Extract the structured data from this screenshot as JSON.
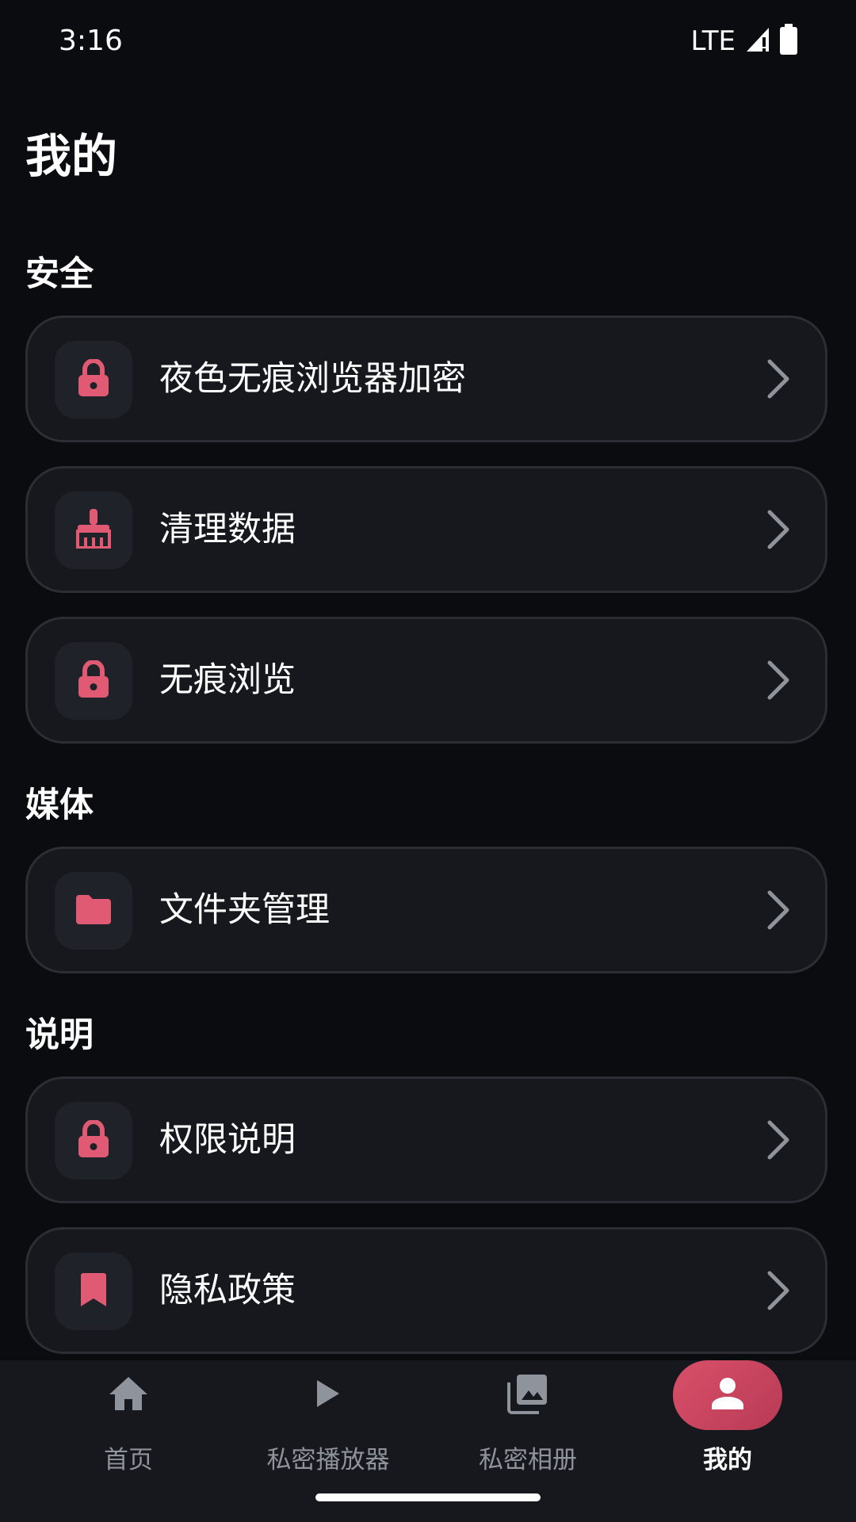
{
  "status_bar": {
    "time": "3:16",
    "network": "LTE"
  },
  "page": {
    "title": "我的"
  },
  "sections": {
    "security": {
      "title": "安全",
      "items": [
        {
          "label": "夜色无痕浏览器加密",
          "icon": "lock-icon"
        },
        {
          "label": "清理数据",
          "icon": "broom-icon"
        },
        {
          "label": "无痕浏览",
          "icon": "lock-icon"
        }
      ]
    },
    "media": {
      "title": "媒体",
      "items": [
        {
          "label": "文件夹管理",
          "icon": "folder-icon"
        }
      ]
    },
    "about": {
      "title": "说明",
      "items": [
        {
          "label": "权限说明",
          "icon": "lock-icon"
        },
        {
          "label": "隐私政策",
          "icon": "bookmark-icon"
        }
      ]
    }
  },
  "bottom_nav": {
    "items": [
      {
        "label": "首页",
        "icon": "home-icon",
        "active": false
      },
      {
        "label": "私密播放器",
        "icon": "play-icon",
        "active": false
      },
      {
        "label": "私密相册",
        "icon": "photo-library-icon",
        "active": false
      },
      {
        "label": "我的",
        "icon": "person-icon",
        "active": true
      }
    ]
  },
  "colors": {
    "accent": "#e05a73",
    "background": "#0b0c0f",
    "card": "#16181d",
    "inactive_nav": "#8e939c"
  }
}
